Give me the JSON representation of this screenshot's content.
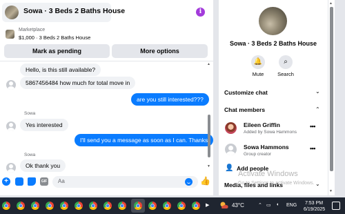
{
  "header": {
    "title": "Sowa · 3 Beds 2 Baths House",
    "info_icon": "i"
  },
  "marketplace": {
    "label": "Marketplace",
    "listing": "$1,000 · 3 Beds 2 Baths House"
  },
  "actions": {
    "mark_pending": "Mark as pending",
    "more_options": "More options"
  },
  "messages": [
    {
      "direction": "in",
      "text": "Hello, is this still available?"
    },
    {
      "direction": "in",
      "text": "5867456484 how much for total move in"
    },
    {
      "direction": "out",
      "text": "are you still interested???"
    },
    {
      "direction": "in",
      "sender": "Sowa",
      "text": "Yes interested"
    },
    {
      "direction": "out",
      "text": "I'll send you a message as soon as I can. Thanks"
    },
    {
      "direction": "in",
      "sender": "Sowa",
      "text": "Ok thank you"
    }
  ],
  "composer": {
    "placeholder": "Aa",
    "gif_label": "GIF"
  },
  "details": {
    "title": "Sowa · 3 Beds 2 Baths House",
    "mute_label": "Mute",
    "search_label": "Search",
    "customize_chat": "Customize chat",
    "chat_members": "Chat members",
    "members": [
      {
        "name": "Eileen Griffin",
        "sub": "Added by Sowa Hammons"
      },
      {
        "name": "Sowa Hammons",
        "sub": "Group creator"
      }
    ],
    "add_people": "Add people",
    "media_files_links": "Media, files and links",
    "watermark_title": "Activate Windows",
    "watermark_sub": "Go to Settings to activate Windows."
  },
  "taskbar": {
    "temperature": "43°C",
    "language": "ENG",
    "time": "7:53 PM",
    "date": "6/19/2025",
    "app_icons": [
      "chrome-icon",
      "chrome-icon",
      "chrome-icon",
      "chrome-icon",
      "chrome-icon",
      "chrome-icon",
      "chrome-icon",
      "chrome-icon",
      "chrome-icon",
      "chrome-icon",
      "chrome-icon",
      "chrome-icon",
      "chrome-icon",
      "chrome-icon"
    ]
  },
  "colors": {
    "messenger_blue": "#0a7cff",
    "info_purple": "#a33bdb",
    "taskbar": "#1f2530"
  }
}
